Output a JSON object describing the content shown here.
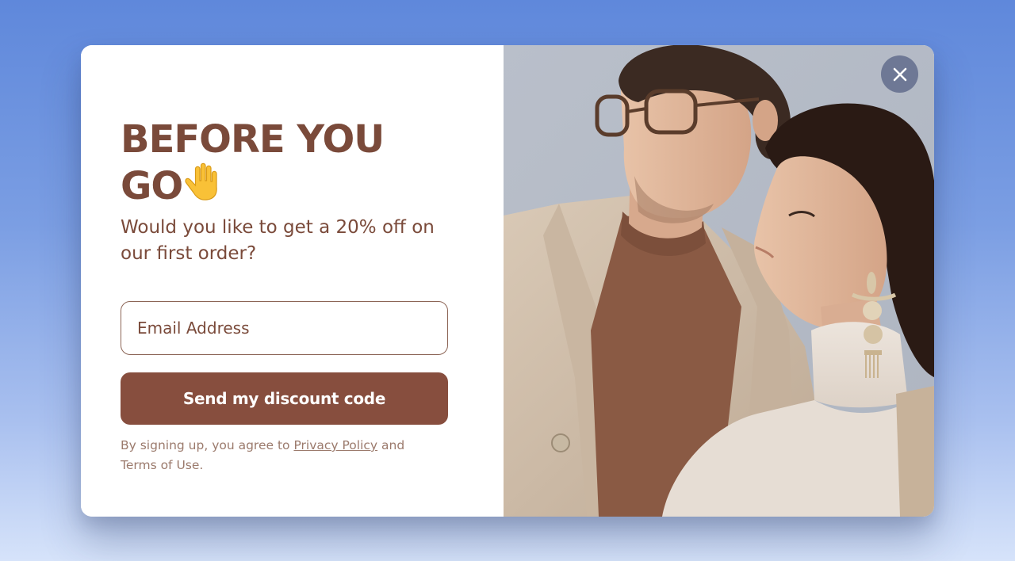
{
  "modal": {
    "heading_line1": "BEFORE YOU",
    "heading_line2": "GO",
    "heading_emoji": "raised-hand-icon",
    "subtitle": "Would you like to get a 20% off on our first order?",
    "email_placeholder": "Email Address",
    "email_value": "",
    "submit_label": "Send my discount code",
    "legal_prefix": "By signing up, you agree to ",
    "privacy_link": "Privacy Policy",
    "legal_suffix": " and Terms of Use.",
    "close_icon": "close-icon",
    "image": "photo-of-fashion-couple-in-beige-outfits"
  },
  "colors": {
    "brand": "#874e3e",
    "heading_text": "#7a4a3a",
    "muted_text": "#9b7a6c",
    "background_top": "#5f88db",
    "background_bottom": "#d6e3fa",
    "close_button": "#626c8c"
  }
}
